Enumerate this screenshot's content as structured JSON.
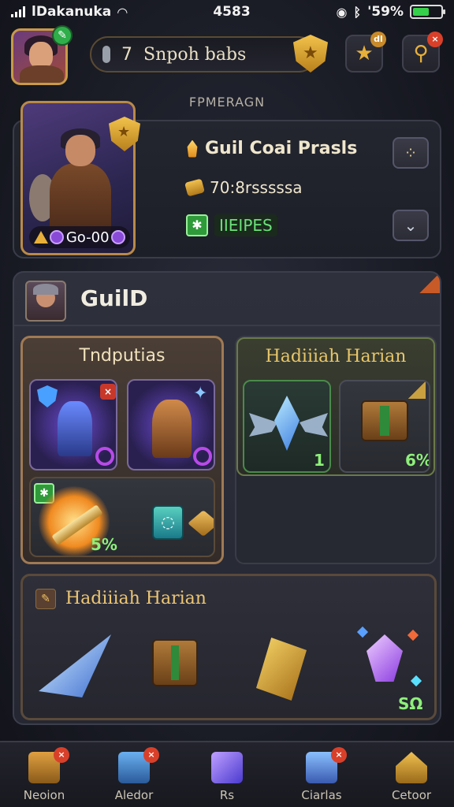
{
  "status_bar": {
    "carrier": "lDakanuka",
    "time": "4583",
    "battery_percent": "'59%",
    "battery_level": 0.59
  },
  "top_bar": {
    "search_number": "7",
    "search_text": "Snpoh babs",
    "star_button_badge": "dl",
    "search_button_badge": "×"
  },
  "section_title": "FPMERAGN",
  "profile_card": {
    "hero_level": "Go-00",
    "title": "Guil  Coai Prasls",
    "subtitle": "70:8rsssssa",
    "tag": "IIEIPES"
  },
  "guild": {
    "title": "GuilD",
    "card_a_title": "Tndputias",
    "card_a_bonus": "5%",
    "card_b_title": "Hadiiiah Harian",
    "card_b_count_1": "1",
    "card_b_count_2": "6%",
    "card_c_title": "Hadiiiah Harian",
    "card_c_count": "SΩ"
  },
  "nav": {
    "items": [
      {
        "label": "Neoion",
        "badge": "×"
      },
      {
        "label": "Aledor",
        "badge": "×"
      },
      {
        "label": "Rs",
        "badge": ""
      },
      {
        "label": "Ciarlas",
        "badge": "×"
      },
      {
        "label": "Cetoor",
        "badge": ""
      }
    ]
  },
  "colors": {
    "accent_gold": "#e8b03a",
    "badge_red": "#d8402a",
    "positive_green": "#8ef07a",
    "panel_bg": "#262832"
  }
}
